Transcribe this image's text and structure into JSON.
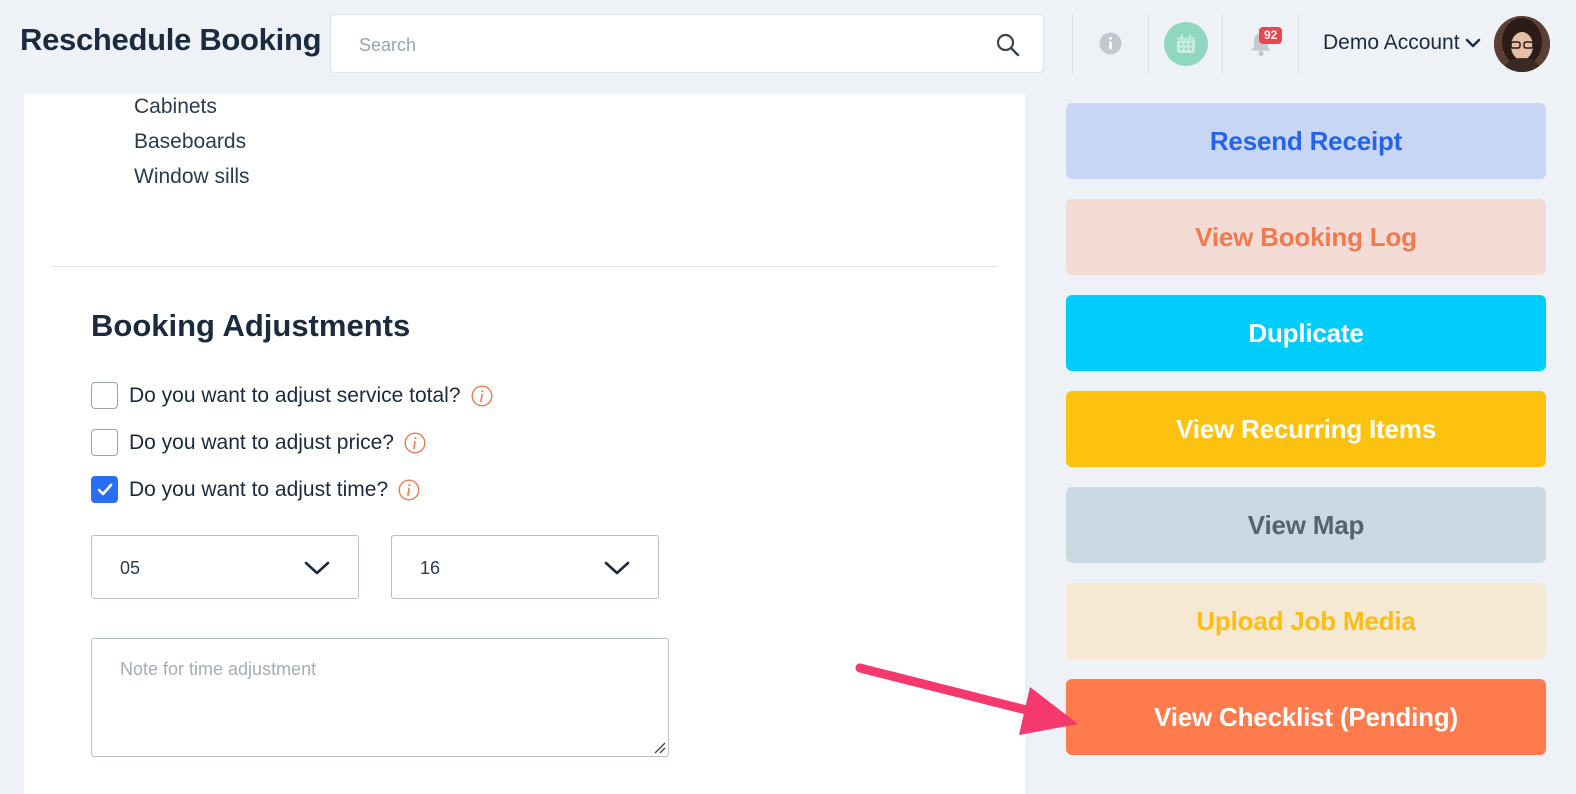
{
  "header": {
    "title": "Reschedule Booking",
    "search_placeholder": "Search",
    "notification_count": "92",
    "account_label": "Demo Account"
  },
  "areas": [
    "Cabinets",
    "Baseboards",
    "Window sills"
  ],
  "adjustments": {
    "title": "Booking Adjustments",
    "options": [
      {
        "label": "Do you want to adjust service total?",
        "checked": false
      },
      {
        "label": "Do you want to adjust price?",
        "checked": false
      },
      {
        "label": "Do you want to adjust time?",
        "checked": true
      }
    ],
    "hours": "05",
    "minutes": "16",
    "note_placeholder": "Note for time adjustment"
  },
  "actions": [
    {
      "label": "Resend Receipt",
      "bg": "#c8d6f6",
      "fg": "#2563eb"
    },
    {
      "label": "View Booking Log",
      "bg": "#f4dcd6",
      "fg": "#f07a4e"
    },
    {
      "label": "Duplicate",
      "bg": "#00cdfc",
      "fg": "#ffffff"
    },
    {
      "label": "View Recurring Items",
      "bg": "#fdc20f",
      "fg": "#ffffff"
    },
    {
      "label": "View Map",
      "bg": "#c9dae3",
      "fg": "#56636f"
    },
    {
      "label": "Upload Job Media",
      "bg": "#f5e9d3",
      "fg": "#fdbd13"
    },
    {
      "label": "View Checklist (Pending)",
      "bg": "#ff7a4d",
      "fg": "#ffffff"
    }
  ],
  "colors": {
    "checkbox_checked": "#2a6ef5",
    "info_icon": "#f07a4e",
    "annotation_arrow": "#f5386e",
    "badge": "#e8474f"
  }
}
